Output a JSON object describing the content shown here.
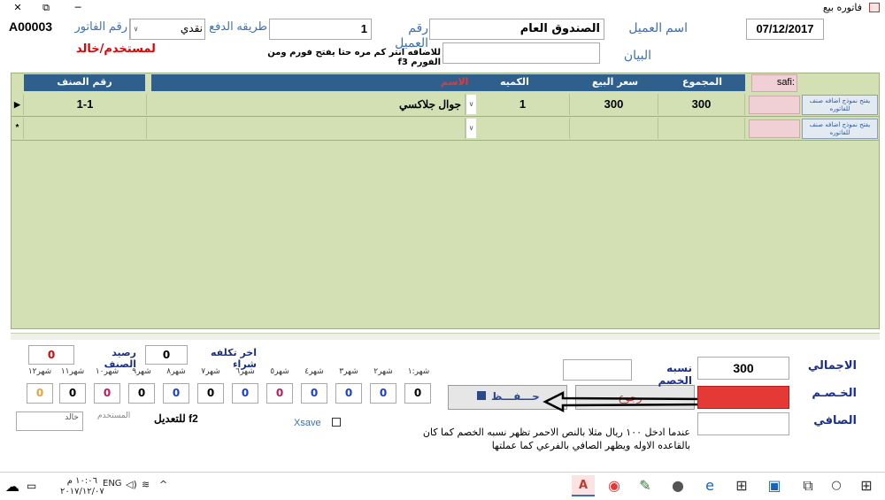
{
  "window": {
    "title": "فاتوره بيع",
    "close_glyph": "✕",
    "restore_glyph": "⧉",
    "minimize_glyph": "─"
  },
  "header": {
    "date": "07/12/2017",
    "customer_name_label": "اسم العميل",
    "customer_name": "الصندوق العام",
    "customer_no_label": "رقم العميل",
    "customer_no": "1",
    "payment_method_label": "طريقه الدفع",
    "payment_method": "نقدي",
    "invoice_no_label": "رقم الفاتور",
    "invoice_no": "A00003",
    "description_label": "البيان",
    "description_hint": "للاضافه انتر كم مره حتا يفتح فورم ومن الفورم f3",
    "user_label": "لمستخدم/خالد"
  },
  "grid": {
    "columns": {
      "item_no": "رقم الصنف",
      "name": "الاسم",
      "qty": "الكميه",
      "price": "سعر البيع",
      "total": "المجموع",
      "safi": "safi:"
    },
    "rows": [
      {
        "marker": "▶",
        "item_no": "1-1",
        "name": "جوال جلاكسي",
        "qty": "1",
        "price": "300",
        "total": "300",
        "safi": "",
        "button": "يفتح نموذج اضافه صنف للفاتوره"
      },
      {
        "marker": "*",
        "item_no": "",
        "name": "",
        "qty": "",
        "price": "",
        "total": "",
        "safi": "",
        "button": "يفتح نموذج اضافه صنف للفاتوره"
      }
    ]
  },
  "stock": {
    "last_purchase_cost_label": "اخر تكلفه شراء",
    "last_purchase_cost": "0",
    "item_balance_label": "رصيد الصنف",
    "item_balance": "0"
  },
  "months": {
    "labels": [
      "شهر:١",
      "شهر٢",
      "شهر٣",
      "شهر٤",
      "شهر٥",
      "شهر٦",
      "شهر٧",
      "شهر٨",
      "شهر٩",
      "شهر١٠",
      "شهر١١",
      "شهر١٢"
    ],
    "values": [
      "0",
      "0",
      "0",
      "0",
      "0",
      "0",
      "0",
      "0",
      "0",
      "0",
      "0",
      "0"
    ],
    "colors": [
      "#000000",
      "#1a3fcf",
      "#1a3fcf",
      "#1a3fcf",
      "#c2185b",
      "#1a3fcf",
      "#000000",
      "#1a3fcf",
      "#000000",
      "#c2185b",
      "#000000",
      "#e6a23c"
    ]
  },
  "footer": {
    "user_small_label": "المستخدم",
    "user_small_value": "خالد",
    "edit_label": "للتعديل f2",
    "xsave_label": "Xsave",
    "save_button": "حـــفـــظ",
    "back_button": "رجوع",
    "note": "عندما ادخل ١٠٠ ريال مثلا  بالنص الاحمر تظهر نسبه الخصم  كما كان بالقاعده الاوله  ويظهر الصافي بالفرعي كما عملتها"
  },
  "totals": {
    "total_label": "الاجمالي",
    "total_value": "300",
    "discount_pct_label": "نسبه الخصم",
    "discount_pct_value": "",
    "discount_label": "الخـصـم",
    "discount_value": "",
    "net_label": "الصافي",
    "net_value": ""
  },
  "taskbar": {
    "time": "١٠:٠٦ م",
    "date": "٢٠١٧/١٢/٠٧",
    "lang": "ENG",
    "icons": [
      "access-icon",
      "chrome-icon",
      "paint-icon",
      "people-icon",
      "edge-icon",
      "store-icon",
      "remote-icon"
    ]
  },
  "colors": {
    "accent_blue": "#3b6fb6",
    "header_bg": "#2f5f8c",
    "grid_bg": "#d3e0b4",
    "discount_red": "#e53935",
    "user_red": "#e00000"
  }
}
